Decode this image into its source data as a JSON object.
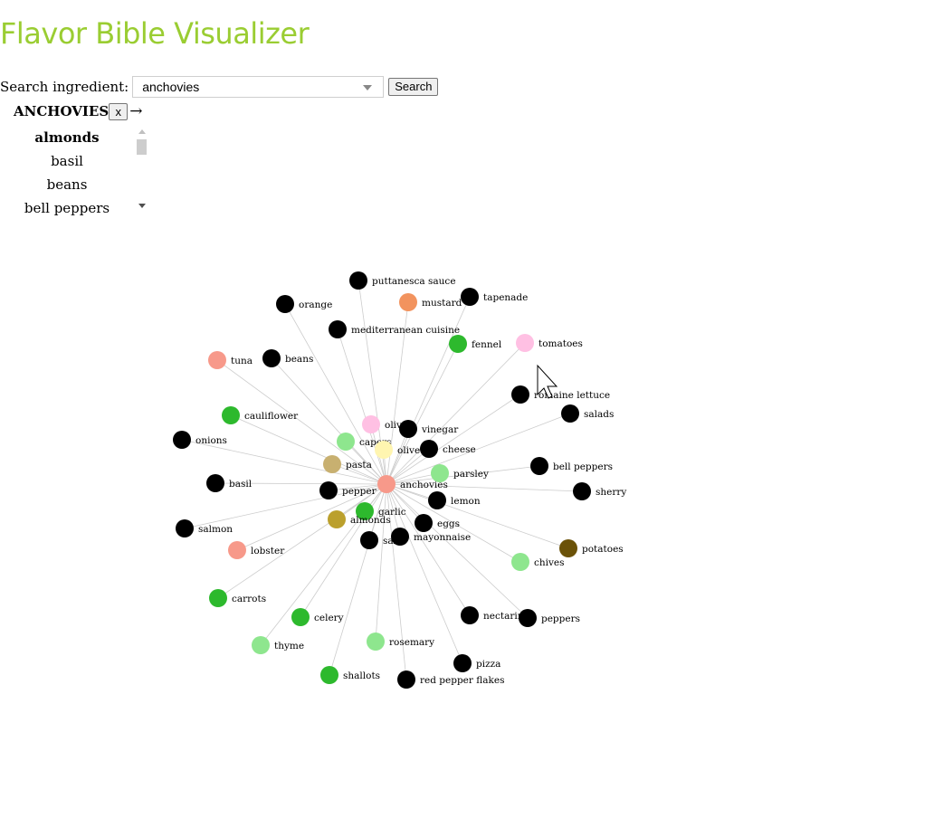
{
  "header": {
    "title": "Flavor Bible Visualizer"
  },
  "search": {
    "label": "Search ingredient:",
    "value": "anchovies",
    "button_label": "Search"
  },
  "selection": {
    "name": "ANCHOVIES",
    "close_label": "x",
    "arrow": "→"
  },
  "pairing_list": {
    "items": [
      "almonds",
      "basil",
      "beans",
      "bell peppers"
    ],
    "active": "almonds"
  },
  "graph": {
    "center": "anchovies",
    "colors": {
      "black": "#000000",
      "green": "#2db92d",
      "light_green": "#8ee68e",
      "salmon": "#f7998a",
      "orange": "#f2935e",
      "pink": "#ffc0e3",
      "yellow": "#fff5b0",
      "tan": "#c8b070",
      "gold": "#bba02d",
      "brown": "#6b5208"
    },
    "nodes": [
      {
        "label": "anchovies",
        "color": "salmon"
      },
      {
        "label": "puttanesca sauce",
        "color": "black"
      },
      {
        "label": "orange",
        "color": "black"
      },
      {
        "label": "mustard",
        "color": "orange"
      },
      {
        "label": "tapenade",
        "color": "black"
      },
      {
        "label": "mediterranean cuisine",
        "color": "black"
      },
      {
        "label": "fennel",
        "color": "green"
      },
      {
        "label": "tomatoes",
        "color": "pink"
      },
      {
        "label": "tuna",
        "color": "salmon"
      },
      {
        "label": "beans",
        "color": "black"
      },
      {
        "label": "romaine lettuce",
        "color": "black"
      },
      {
        "label": "salads",
        "color": "black"
      },
      {
        "label": "cauliflower",
        "color": "green"
      },
      {
        "label": "olives",
        "color": "pink"
      },
      {
        "label": "vinegar",
        "color": "black"
      },
      {
        "label": "onions",
        "color": "black"
      },
      {
        "label": "capers",
        "color": "light_green"
      },
      {
        "label": "olive oil",
        "color": "yellow"
      },
      {
        "label": "cheese",
        "color": "black"
      },
      {
        "label": "pasta",
        "color": "tan"
      },
      {
        "label": "parsley",
        "color": "light_green"
      },
      {
        "label": "bell peppers",
        "color": "black"
      },
      {
        "label": "basil",
        "color": "black"
      },
      {
        "label": "pepper",
        "color": "black"
      },
      {
        "label": "sherry",
        "color": "black"
      },
      {
        "label": "lemon",
        "color": "black"
      },
      {
        "label": "garlic",
        "color": "green"
      },
      {
        "label": "almonds",
        "color": "gold"
      },
      {
        "label": "eggs",
        "color": "black"
      },
      {
        "label": "salmon",
        "color": "black"
      },
      {
        "label": "mayonnaise",
        "color": "black"
      },
      {
        "label": "salt",
        "color": "black"
      },
      {
        "label": "potatoes",
        "color": "brown"
      },
      {
        "label": "lobster",
        "color": "salmon"
      },
      {
        "label": "chives",
        "color": "light_green"
      },
      {
        "label": "carrots",
        "color": "green"
      },
      {
        "label": "nectarines",
        "color": "black"
      },
      {
        "label": "peppers",
        "color": "black"
      },
      {
        "label": "celery",
        "color": "green"
      },
      {
        "label": "rosemary",
        "color": "light_green"
      },
      {
        "label": "thyme",
        "color": "light_green"
      },
      {
        "label": "pizza",
        "color": "black"
      },
      {
        "label": "shallots",
        "color": "green"
      },
      {
        "label": "red pepper flakes",
        "color": "black"
      }
    ]
  }
}
